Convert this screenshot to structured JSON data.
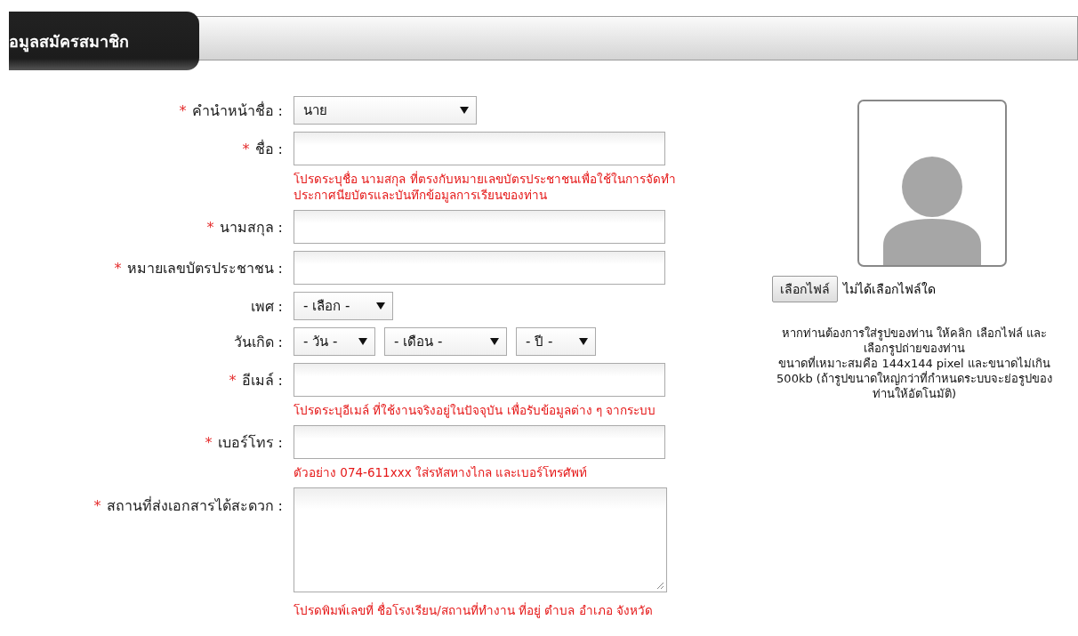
{
  "header": {
    "title": "อมูลสมัครสมาชิก"
  },
  "fields": [
    {
      "kind": "select",
      "label": "คำนำหน้าชื่อ :",
      "mark": "*",
      "selects": [
        {
          "value": "นาย"
        }
      ]
    },
    {
      "kind": "text",
      "label": "ชื่อ :",
      "mark": "*",
      "hint": "โปรดระบุชื่อ นามสกุล ที่ตรงกับหมายเลขบัตรประชาชนเพื่อใช้ในการจัดทำ ประกาศนียบัตรและบันทึกข้อมูลการเรียนของท่าน"
    },
    {
      "kind": "text",
      "label": "นามสกุล :",
      "mark": "*"
    },
    {
      "kind": "text",
      "label": "หมายเลขบัตรประชาชน :",
      "mark": "*"
    },
    {
      "kind": "select",
      "label": "เพศ :",
      "selects": [
        {
          "value": "- เลือก -"
        }
      ]
    },
    {
      "kind": "select",
      "label": "วันเกิด :",
      "selects": [
        {
          "value": "- วัน -"
        },
        {
          "value": "- เดือน -"
        },
        {
          "value": "- ปี -"
        }
      ]
    },
    {
      "kind": "text",
      "label": "อีเมล์ :",
      "mark": "*",
      "hint": "โปรดระบุอีเมล์ ที่ใช้งานจริงอยู่ในปัจจุบัน เพื่อรับข้อมูลต่าง ๆ จากระบบ"
    },
    {
      "kind": "text",
      "label": "เบอร์โทร :",
      "mark": "*",
      "hint": "ตัวอย่าง 074-611xxx ใส่รหัสทางไกล และเบอร์โทรศัพท์"
    },
    {
      "kind": "textarea",
      "label": "สถานที่ส่งเอกสารได้สะดวก :",
      "mark": "*",
      "hint": "โปรดพิมพ์เลขที่ ชื่อโรงเรียน/สถานที่ทำงาน ที่อยู่ ตำบล อำเภอ จังหวัด"
    }
  ],
  "photo": {
    "button": "เลือกไฟล์",
    "status": "ไม่ได้เลือกไฟล์ใด",
    "note": [
      "หากท่านต้องการใส่รูปของท่าน ให้คลิก เลือกไฟล์ และเลือกรูปถ่ายของท่าน",
      "ขนาดที่เหมาะสมคือ 144x144 pixel และขนาดไม่เกิน 500kb (ถ้ารูปขนาดใหญ่กว่าที่กำหนดระบบจะย่อรูปของท่านให้อัตโนมัติ)"
    ]
  }
}
